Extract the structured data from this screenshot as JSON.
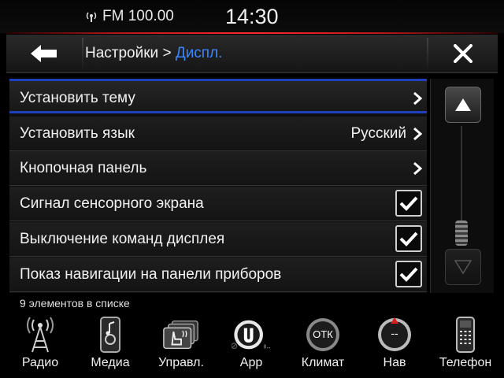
{
  "status": {
    "radio": "FM 100.00",
    "clock": "14:30"
  },
  "header": {
    "breadcrumb_root": "Настройки",
    "breadcrumb_sep": " > ",
    "breadcrumb_current": "Диспл."
  },
  "list": {
    "items": [
      {
        "label": "Установить тему",
        "control": "chevron"
      },
      {
        "label": "Установить язык",
        "value": "Русский",
        "control": "chevron"
      },
      {
        "label": "Кнопочная панель",
        "control": "chevron"
      },
      {
        "label": "Сигнал сенсорного экрана",
        "control": "checkbox",
        "checked": true
      },
      {
        "label": "Выключение команд дисплея",
        "control": "checkbox",
        "checked": true
      },
      {
        "label": "Показ навигации на панели приборов",
        "control": "checkbox",
        "checked": true
      }
    ],
    "count_text": "9 элементов в списке"
  },
  "nav": {
    "items": [
      {
        "label": "Радио",
        "icon": "radio-tower-icon"
      },
      {
        "label": "Медиа",
        "icon": "media-player-icon"
      },
      {
        "label": "Управл.",
        "icon": "seat-heat-controls-icon"
      },
      {
        "label": "App",
        "icon": "uconnect-app-icon"
      },
      {
        "label": "Климат",
        "icon": "climate-icon",
        "badge": "ОТК"
      },
      {
        "label": "Нав",
        "icon": "navigation-compass-icon",
        "badge": "--"
      },
      {
        "label": "Телефон",
        "icon": "phone-icon"
      }
    ]
  },
  "colors": {
    "accent_blue": "#3a86ff",
    "selection_border": "#1e3fbf",
    "status_glow": "#ff2a2a"
  }
}
